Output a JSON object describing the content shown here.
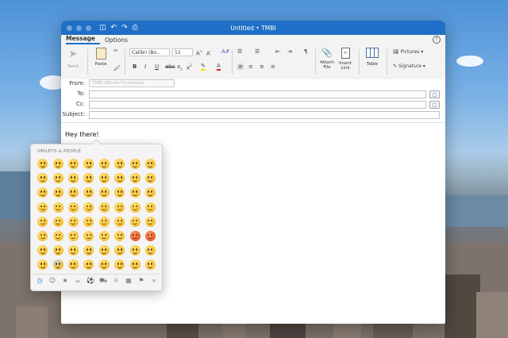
{
  "window": {
    "title": "Untitled • TMBI"
  },
  "tabs": [
    {
      "label": "Message",
      "active": true
    },
    {
      "label": "Options",
      "active": false
    }
  ],
  "ribbon": {
    "send_label": "Send",
    "paste_label": "Paste",
    "font_name": "Calibri (Bo...",
    "font_size": "11",
    "attach_file_label": "Attach\nFile",
    "insert_link_label": "Insert\nLink",
    "table_label": "Table",
    "pictures_label": "Pictures",
    "signature_label": "Signature"
  },
  "compose": {
    "from_label": "From:",
    "from_value": "TMBI (Nicole Fornabaio)",
    "to_label": "To:",
    "cc_label": "Cc:",
    "subject_label": "Subject:",
    "body_text": "Hey there!"
  },
  "emoji_picker": {
    "section_title": "SMILEYS & PEOPLE",
    "categories": [
      "clock-icon",
      "smiley-icon",
      "animal-icon",
      "food-icon",
      "ball-icon",
      "car-icon",
      "bulb-icon",
      "symbols-icon",
      "flag-icon",
      "more-icon"
    ]
  },
  "colors": {
    "accent": "#1f6fc6"
  }
}
